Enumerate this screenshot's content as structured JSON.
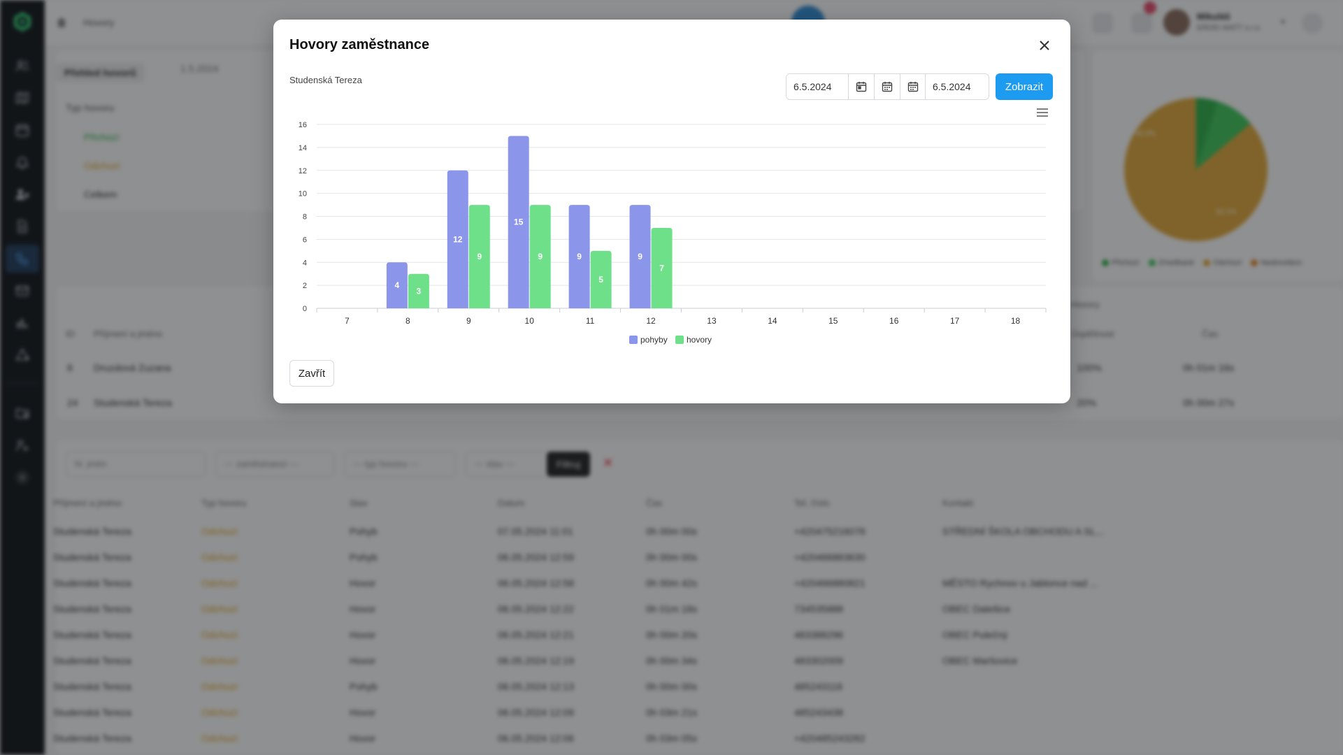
{
  "modal": {
    "title": "Hovory zaměstnance",
    "employee": "Studenská Tereza",
    "date_from": "6.5.2024",
    "date_to": "6.5.2024",
    "show_label": "Zobrazit",
    "close_label": "Zavřít"
  },
  "chart_data": {
    "type": "bar",
    "categories": [
      "7",
      "8",
      "9",
      "10",
      "11",
      "12",
      "13",
      "14",
      "15",
      "16",
      "17",
      "18"
    ],
    "series": [
      {
        "name": "pohyby",
        "values": [
          0,
          4,
          12,
          15,
          9,
          9,
          0,
          0,
          0,
          0,
          0,
          0
        ],
        "color": "#8b96ea"
      },
      {
        "name": "hovory",
        "values": [
          0,
          3,
          9,
          9,
          5,
          7,
          0,
          0,
          0,
          0,
          0,
          0
        ],
        "color": "#6ee08a"
      }
    ],
    "ylim": [
      0,
      16
    ],
    "yticks": [
      "0",
      "2",
      "4",
      "6",
      "8",
      "10",
      "12",
      "14",
      "16"
    ],
    "grid": true,
    "legend_position": "bottom-center",
    "data_labels": true
  },
  "background": {
    "breadcrumb": "Hovory",
    "user_name": "Mikuláš",
    "user_company": "ERDEI MATT s.r.o.",
    "overview_tab": "Přehled hovorů",
    "overview_date": "1.5.2024",
    "call_type_header": "Typ hovoru",
    "call_types": [
      "Přichozí",
      "Odchozí",
      "Celkem"
    ],
    "pie_labels": [
      "Přichozí",
      "Zmeškané",
      "Odchozí",
      "Nedovoláno"
    ],
    "pie_value_labels": [
      "66.3%",
      "82.1%"
    ],
    "pie_caption": "Hovory",
    "employee_table": {
      "headers": [
        "ID",
        "Příjmení a jméno",
        "Úspěšnost",
        "Čas"
      ],
      "rows": [
        [
          "8",
          "Druzdová Zuzana",
          "100%",
          "0h 01m 16s"
        ],
        [
          "24",
          "Studenská Tereza",
          "20%",
          "0h 00m 27s"
        ]
      ]
    },
    "filters": {
      "search_placeholder": "hl. jmén",
      "employee": "--- zaměstnanci ---",
      "call_type": "--- typ hovoru ---",
      "state": "--- stav ---",
      "filter_button": "Filtruj"
    },
    "calls_table": {
      "headers": [
        "Příjmení a jméno",
        "Typ hovoru",
        "Stav",
        "Datum",
        "Čas",
        "Tel. číslo",
        "Kontakt"
      ],
      "rows": [
        [
          "Studenská Tereza",
          "Odchozí",
          "Pohyb",
          "07.05.2024 11:01",
          "0h 00m 00s",
          "+420475216078",
          "STŘEDNÍ ŠKOLA OBCHODU A SL..."
        ],
        [
          "Studenská Tereza",
          "Odchozí",
          "Pohyb",
          "06.05.2024 12:59",
          "0h 00m 00s",
          "+420466883630",
          ""
        ],
        [
          "Studenská Tereza",
          "Odchozí",
          "Hovor",
          "06.05.2024 12:58",
          "0h 00m 42s",
          "+420466880821",
          "MĚSTO Rychnov u Jablonce nad ..."
        ],
        [
          "Studenská Tereza",
          "Odchozí",
          "Hovor",
          "06.05.2024 12:22",
          "0h 01m 18s",
          "734535888",
          "OBEC Dalešice"
        ],
        [
          "Studenská Tereza",
          "Odchozí",
          "Hovor",
          "06.05.2024 12:21",
          "0h 00m 20s",
          "483388296",
          "OBEC Pulečný"
        ],
        [
          "Studenská Tereza",
          "Odchozí",
          "Hovor",
          "06.05.2024 12:19",
          "0h 00m 34s",
          "483302009",
          "OBEC Maršovice"
        ],
        [
          "Studenská Tereza",
          "Odchozí",
          "Pohyb",
          "06.05.2024 12:13",
          "0h 00m 00s",
          "485243118",
          ""
        ],
        [
          "Studenská Tereza",
          "Odchozí",
          "Hovor",
          "06.05.2024 12:09",
          "0h 03m 21s",
          "485243438",
          ""
        ],
        [
          "Studenská Tereza",
          "Odchozí",
          "Hovor",
          "06.05.2024 12:06",
          "0h 03m 05s",
          "+420485243282",
          ""
        ]
      ]
    }
  }
}
